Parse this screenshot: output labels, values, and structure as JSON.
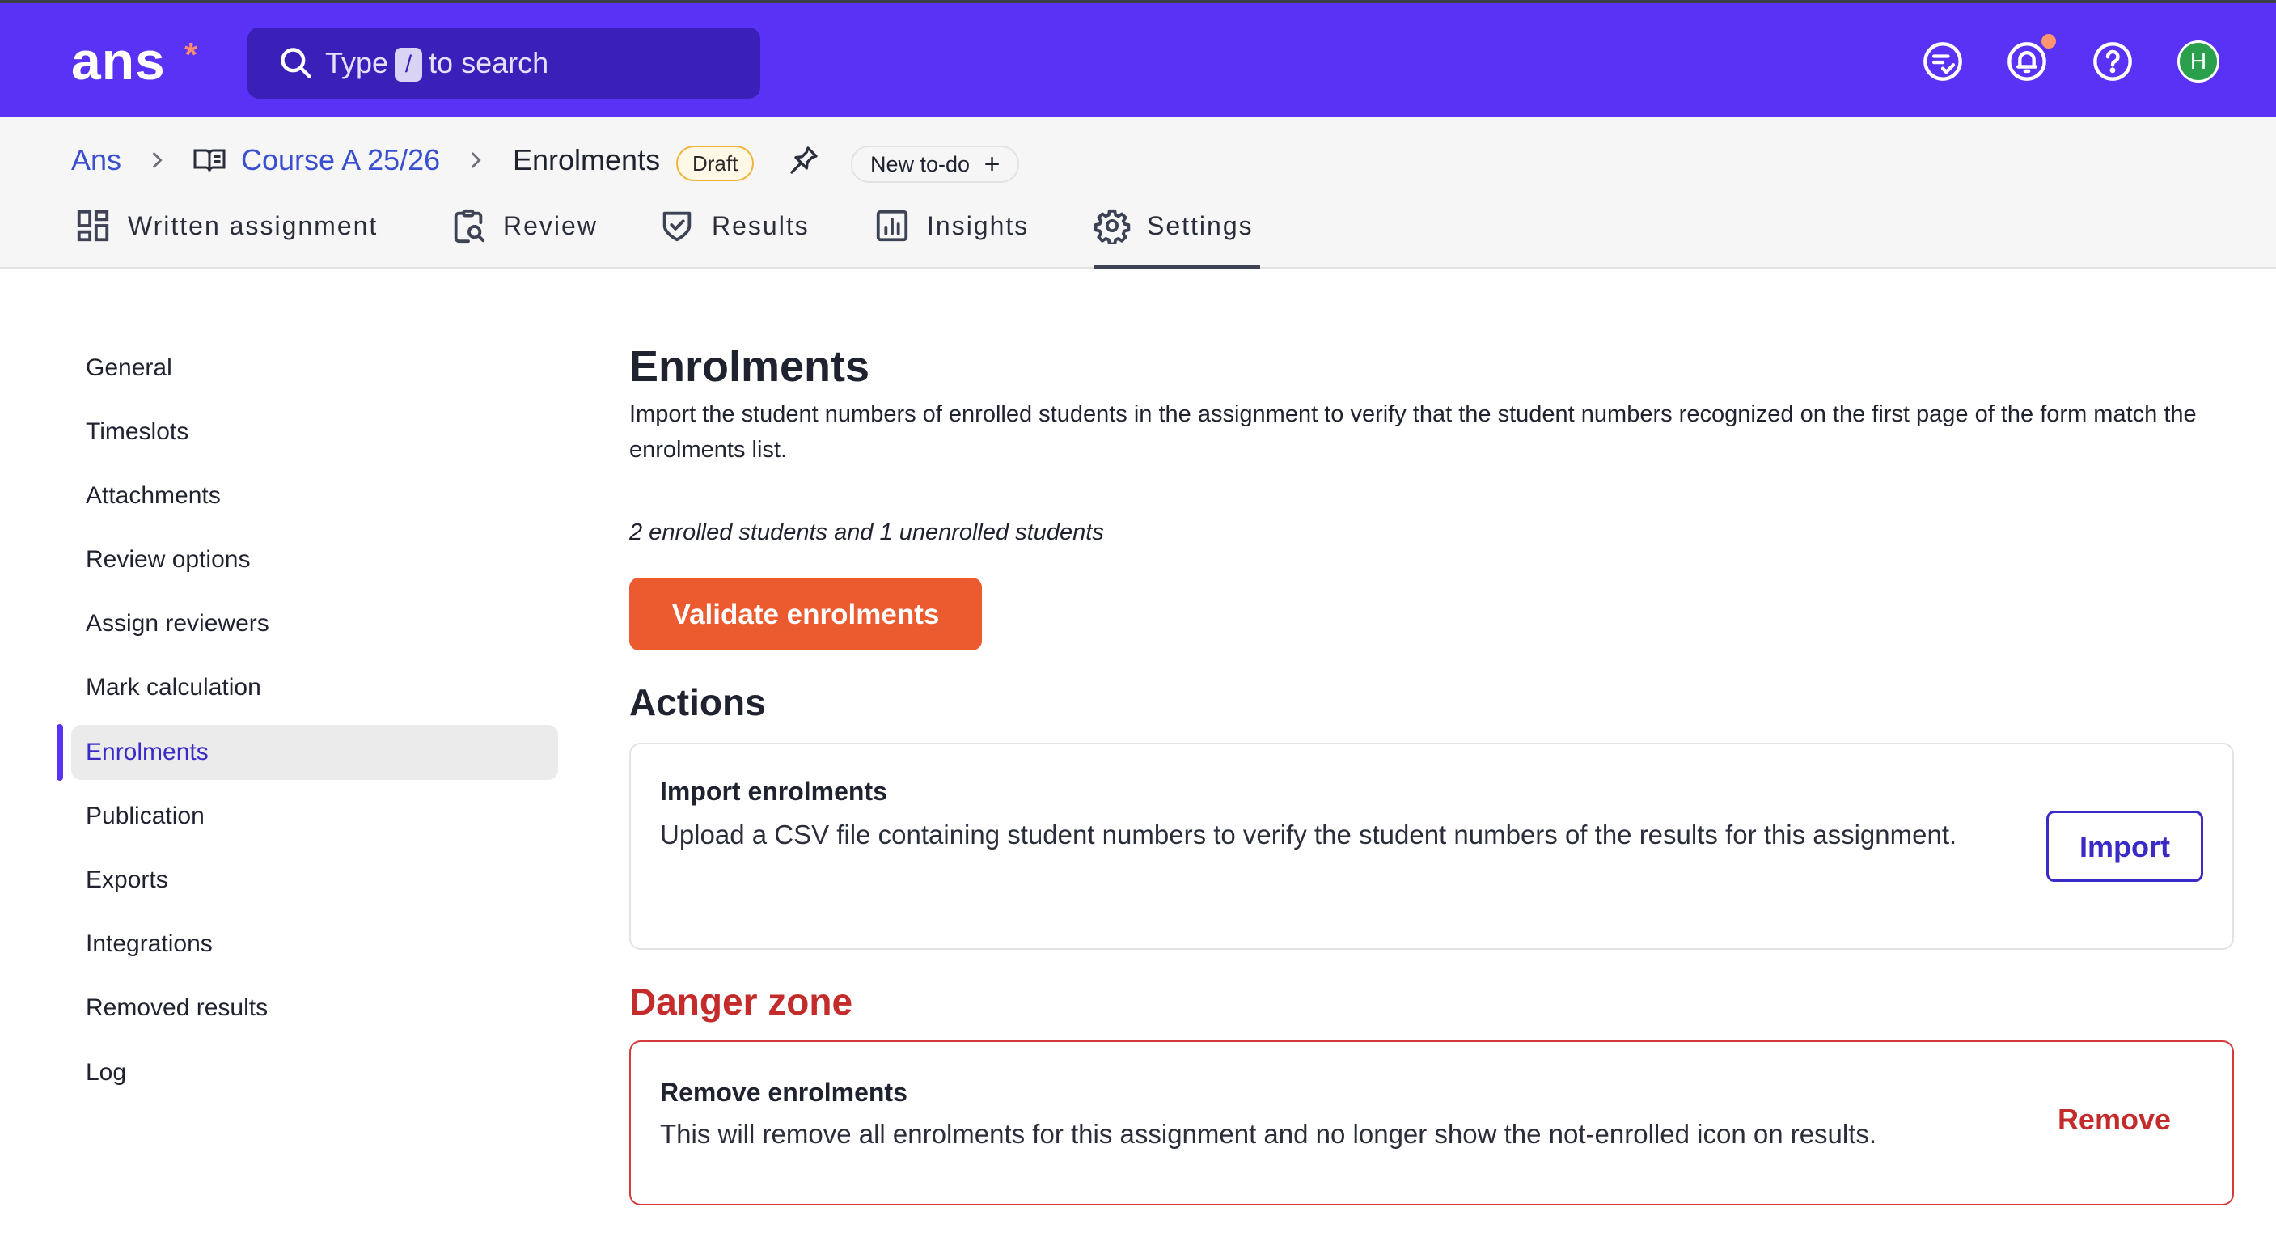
{
  "topbar": {
    "logo": "ans",
    "logo_mark": "*",
    "search": {
      "before": "Type",
      "key": "/",
      "after": "to search"
    },
    "avatar_initial": "H",
    "icons": [
      "feedback-icon",
      "bell-icon",
      "help-icon"
    ],
    "colors": {
      "bar": "#5a32f5",
      "notification_dot": "#ff9670",
      "avatar": "#2aa04c"
    }
  },
  "breadcrumb": {
    "root": "Ans",
    "course": "Course A 25/26",
    "current": "Enrolments",
    "status_badge": "Draft",
    "new_todo": "New to-do"
  },
  "tabs": [
    {
      "label": "Written assignment",
      "icon": "layout-icon"
    },
    {
      "label": "Review",
      "icon": "clipboard-search-icon"
    },
    {
      "label": "Results",
      "icon": "shield-check-icon"
    },
    {
      "label": "Insights",
      "icon": "bar-chart-icon"
    },
    {
      "label": "Settings",
      "icon": "gear-icon",
      "active": true
    }
  ],
  "sidebar": {
    "items": [
      {
        "label": "General"
      },
      {
        "label": "Timeslots"
      },
      {
        "label": "Attachments"
      },
      {
        "label": "Review options"
      },
      {
        "label": "Assign reviewers"
      },
      {
        "label": "Mark calculation"
      },
      {
        "label": "Enrolments",
        "active": true
      },
      {
        "label": "Publication"
      },
      {
        "label": "Exports"
      },
      {
        "label": "Integrations"
      },
      {
        "label": "Removed results"
      },
      {
        "label": "Log"
      }
    ]
  },
  "main": {
    "title": "Enrolments",
    "description": "Import the student numbers of enrolled students in the assignment to verify that the student numbers recognized on the first page of the form match the enrolments list.",
    "summary": "2 enrolled students and 1 unenrolled students",
    "validate_label": "Validate enrolments",
    "actions_title": "Actions",
    "import_card": {
      "title": "Import enrolments",
      "description": "Upload a CSV file containing student numbers to verify the student numbers of the results for this assignment.",
      "button": "Import"
    },
    "danger_title": "Danger zone",
    "remove_card": {
      "title": "Remove enrolments",
      "description": "This will remove all enrolments for this assignment and no longer show the not-enrolled icon on results.",
      "button": "Remove"
    },
    "colors": {
      "primary_action": "#ec5a2f",
      "danger": "#c42b2b",
      "accent": "#3a2bc7"
    }
  }
}
